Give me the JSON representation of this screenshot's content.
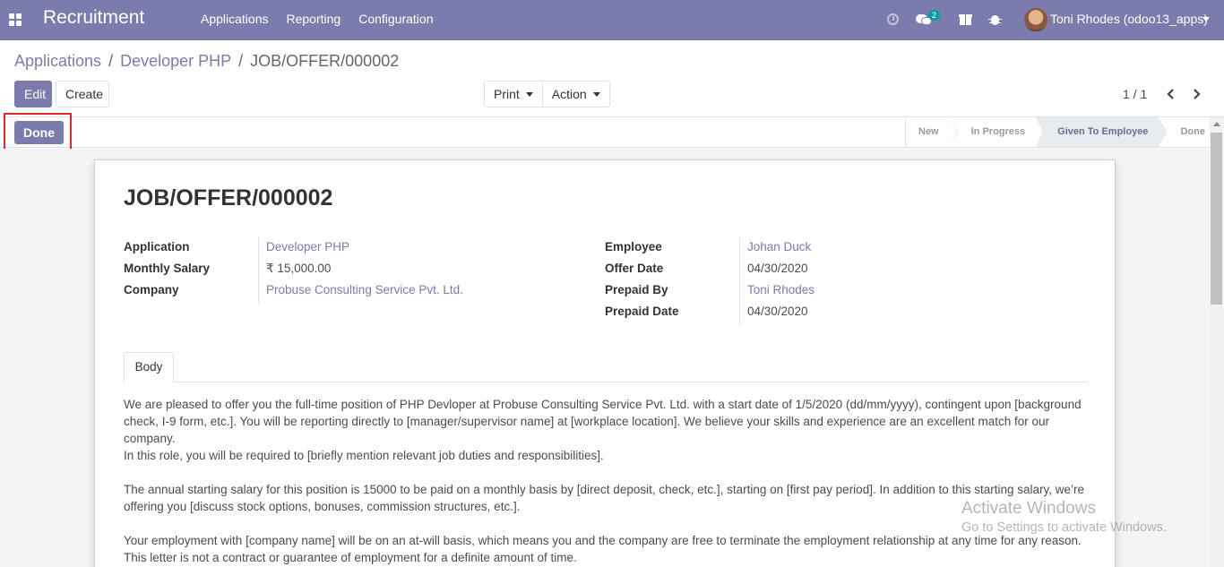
{
  "navbar": {
    "app_title": "Recruitment",
    "menu": [
      "Applications",
      "Reporting",
      "Configuration"
    ],
    "message_count": "2",
    "user_name": "Toni Rhodes (odoo13_apps)"
  },
  "breadcrumb": {
    "items": [
      "Applications",
      "Developer PHP"
    ],
    "separator": "/",
    "current": "JOB/OFFER/000002"
  },
  "toolbar": {
    "edit_label": "Edit",
    "create_label": "Create",
    "print_label": "Print",
    "action_label": "Action",
    "pager": "1 / 1"
  },
  "statusbar": {
    "done_label": "Done",
    "stages": [
      "New",
      "In Progress",
      "Given To Employee",
      "Done"
    ],
    "current_stage": "Given To Employee"
  },
  "record": {
    "title": "JOB/OFFER/000002",
    "left_fields": [
      {
        "label": "Application",
        "value": "Developer PHP"
      },
      {
        "label": "Monthly Salary",
        "value": "₹ 15,000.00"
      },
      {
        "label": "Company",
        "value": "Probuse Consulting Service Pvt. Ltd."
      }
    ],
    "right_fields": [
      {
        "label": "Employee",
        "value": "Johan Duck"
      },
      {
        "label": "Offer Date",
        "value": "04/30/2020"
      },
      {
        "label": "Prepaid By",
        "value": "Toni Rhodes"
      },
      {
        "label": "Prepaid Date",
        "value": "04/30/2020"
      }
    ],
    "tab_label": "Body",
    "body": [
      "We are pleased to offer you the full-time position of PHP Devloper at Probuse Consulting Service Pvt. Ltd. with a start date of 1/5/2020 (dd/mm/yyyy), contingent upon [background check, I-9 form, etc.]. You will be reporting directly to [manager/supervisor name] at [workplace location]. We believe your skills and experience are an excellent match for our company.",
      "In this role, you will be required to [briefly mention relevant job duties and responsibilities].",
      "The annual starting salary for this position is 15000 to be paid on a monthly basis by [direct deposit, check, etc.], starting on [first pay period]. In addition to this starting salary, we’re offering you [discuss stock options, bonuses, commission structures, etc.].",
      "Your employment with [company name] will be on an at-will basis, which means you and the company are free to terminate the employment relationship at any time for any reason. This letter is not a contract or guarantee of employment for a definite amount of time."
    ]
  },
  "watermark": {
    "line1": "Activate Windows",
    "line2": "Go to Settings to activate Windows."
  },
  "colors": {
    "brand": "#7c7bad",
    "highlight": "#e0282b",
    "badge": "#00a09d"
  }
}
